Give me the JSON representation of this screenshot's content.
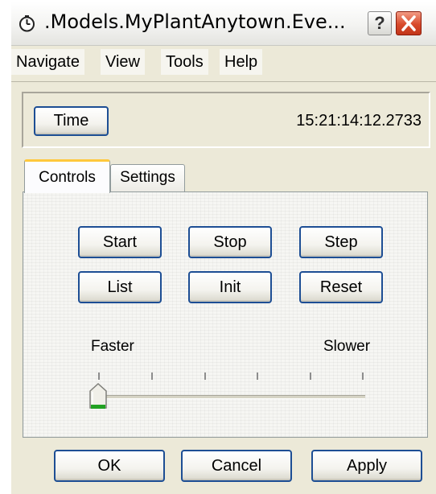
{
  "window": {
    "title": ".Models.MyPlantAnytown.Eve...",
    "icon": "clock-icon",
    "help_label": "?",
    "close_icon": "close-icon"
  },
  "menu": {
    "items": [
      {
        "label": "Navigate"
      },
      {
        "label": "View"
      },
      {
        "label": "Tools"
      },
      {
        "label": "Help"
      }
    ]
  },
  "time": {
    "button_label": "Time",
    "value": "15:21:14:12.2733"
  },
  "tabs": [
    {
      "label": "Controls",
      "selected": true
    },
    {
      "label": "Settings",
      "selected": false
    }
  ],
  "controls": {
    "buttons": [
      {
        "label": "Start"
      },
      {
        "label": "Stop"
      },
      {
        "label": "Step"
      },
      {
        "label": "List"
      },
      {
        "label": "Init"
      },
      {
        "label": "Reset"
      }
    ],
    "speed": {
      "min_label": "Faster",
      "max_label": "Slower",
      "position": 0,
      "tick_count": 6
    }
  },
  "dialog_buttons": {
    "ok": "OK",
    "cancel": "Cancel",
    "apply": "Apply"
  },
  "colors": {
    "button_border": "#1d4e94",
    "tab_highlight": "#ffc83c",
    "close_red": "#d84a2b",
    "window_face": "#ece9d8"
  }
}
